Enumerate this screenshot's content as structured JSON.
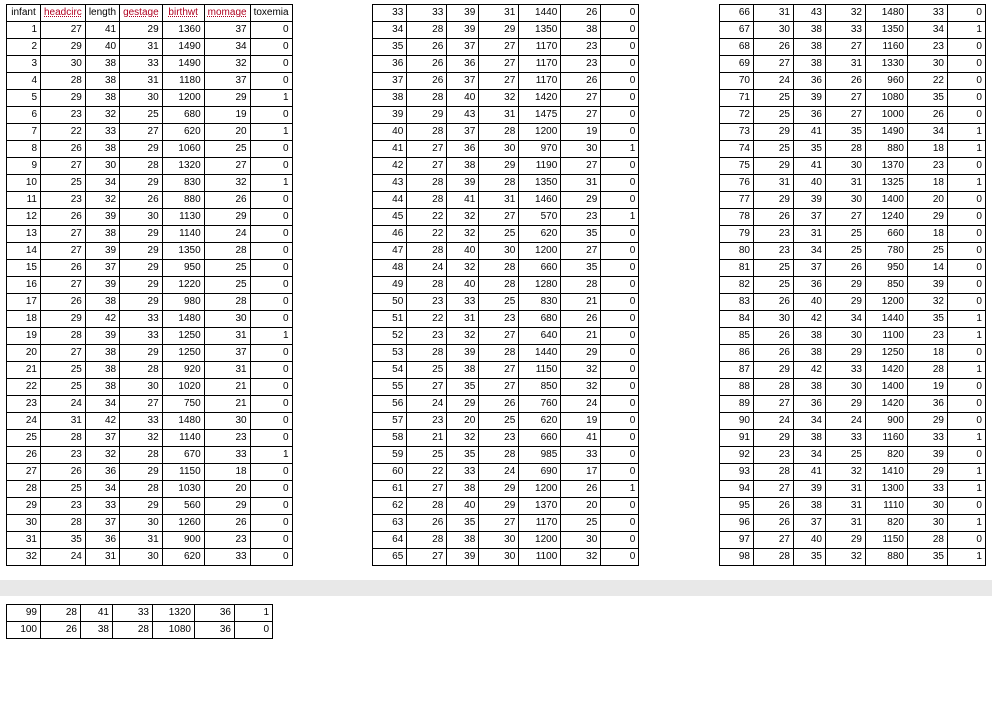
{
  "headers": {
    "infant": {
      "label": "infant",
      "styled": false
    },
    "headcirc": {
      "label": "headcirc",
      "styled": true
    },
    "length": {
      "label": "length",
      "styled": false
    },
    "gestage": {
      "label": "gestage",
      "styled": true
    },
    "birthwt": {
      "label": "birthwt",
      "styled": true
    },
    "momage": {
      "label": "momage",
      "styled": true
    },
    "toxemia": {
      "label": "toxemia",
      "styled": false
    }
  },
  "rows": [
    {
      "infant": 1,
      "headcirc": 27,
      "length": 41,
      "gestage": 29,
      "birthwt": 1360,
      "momage": 37,
      "toxemia": 0
    },
    {
      "infant": 2,
      "headcirc": 29,
      "length": 40,
      "gestage": 31,
      "birthwt": 1490,
      "momage": 34,
      "toxemia": 0
    },
    {
      "infant": 3,
      "headcirc": 30,
      "length": 38,
      "gestage": 33,
      "birthwt": 1490,
      "momage": 32,
      "toxemia": 0
    },
    {
      "infant": 4,
      "headcirc": 28,
      "length": 38,
      "gestage": 31,
      "birthwt": 1180,
      "momage": 37,
      "toxemia": 0
    },
    {
      "infant": 5,
      "headcirc": 29,
      "length": 38,
      "gestage": 30,
      "birthwt": 1200,
      "momage": 29,
      "toxemia": 1
    },
    {
      "infant": 6,
      "headcirc": 23,
      "length": 32,
      "gestage": 25,
      "birthwt": 680,
      "momage": 19,
      "toxemia": 0
    },
    {
      "infant": 7,
      "headcirc": 22,
      "length": 33,
      "gestage": 27,
      "birthwt": 620,
      "momage": 20,
      "toxemia": 1
    },
    {
      "infant": 8,
      "headcirc": 26,
      "length": 38,
      "gestage": 29,
      "birthwt": 1060,
      "momage": 25,
      "toxemia": 0
    },
    {
      "infant": 9,
      "headcirc": 27,
      "length": 30,
      "gestage": 28,
      "birthwt": 1320,
      "momage": 27,
      "toxemia": 0
    },
    {
      "infant": 10,
      "headcirc": 25,
      "length": 34,
      "gestage": 29,
      "birthwt": 830,
      "momage": 32,
      "toxemia": 1
    },
    {
      "infant": 11,
      "headcirc": 23,
      "length": 32,
      "gestage": 26,
      "birthwt": 880,
      "momage": 26,
      "toxemia": 0
    },
    {
      "infant": 12,
      "headcirc": 26,
      "length": 39,
      "gestage": 30,
      "birthwt": 1130,
      "momage": 29,
      "toxemia": 0
    },
    {
      "infant": 13,
      "headcirc": 27,
      "length": 38,
      "gestage": 29,
      "birthwt": 1140,
      "momage": 24,
      "toxemia": 0
    },
    {
      "infant": 14,
      "headcirc": 27,
      "length": 39,
      "gestage": 29,
      "birthwt": 1350,
      "momage": 28,
      "toxemia": 0
    },
    {
      "infant": 15,
      "headcirc": 26,
      "length": 37,
      "gestage": 29,
      "birthwt": 950,
      "momage": 25,
      "toxemia": 0
    },
    {
      "infant": 16,
      "headcirc": 27,
      "length": 39,
      "gestage": 29,
      "birthwt": 1220,
      "momage": 25,
      "toxemia": 0
    },
    {
      "infant": 17,
      "headcirc": 26,
      "length": 38,
      "gestage": 29,
      "birthwt": 980,
      "momage": 28,
      "toxemia": 0
    },
    {
      "infant": 18,
      "headcirc": 29,
      "length": 42,
      "gestage": 33,
      "birthwt": 1480,
      "momage": 30,
      "toxemia": 0
    },
    {
      "infant": 19,
      "headcirc": 28,
      "length": 39,
      "gestage": 33,
      "birthwt": 1250,
      "momage": 31,
      "toxemia": 1
    },
    {
      "infant": 20,
      "headcirc": 27,
      "length": 38,
      "gestage": 29,
      "birthwt": 1250,
      "momage": 37,
      "toxemia": 0
    },
    {
      "infant": 21,
      "headcirc": 25,
      "length": 38,
      "gestage": 28,
      "birthwt": 920,
      "momage": 31,
      "toxemia": 0
    },
    {
      "infant": 22,
      "headcirc": 25,
      "length": 38,
      "gestage": 30,
      "birthwt": 1020,
      "momage": 21,
      "toxemia": 0
    },
    {
      "infant": 23,
      "headcirc": 24,
      "length": 34,
      "gestage": 27,
      "birthwt": 750,
      "momage": 21,
      "toxemia": 0
    },
    {
      "infant": 24,
      "headcirc": 31,
      "length": 42,
      "gestage": 33,
      "birthwt": 1480,
      "momage": 30,
      "toxemia": 0
    },
    {
      "infant": 25,
      "headcirc": 28,
      "length": 37,
      "gestage": 32,
      "birthwt": 1140,
      "momage": 23,
      "toxemia": 0
    },
    {
      "infant": 26,
      "headcirc": 23,
      "length": 32,
      "gestage": 28,
      "birthwt": 670,
      "momage": 33,
      "toxemia": 1
    },
    {
      "infant": 27,
      "headcirc": 26,
      "length": 36,
      "gestage": 29,
      "birthwt": 1150,
      "momage": 18,
      "toxemia": 0
    },
    {
      "infant": 28,
      "headcirc": 25,
      "length": 34,
      "gestage": 28,
      "birthwt": 1030,
      "momage": 20,
      "toxemia": 0
    },
    {
      "infant": 29,
      "headcirc": 23,
      "length": 33,
      "gestage": 29,
      "birthwt": 560,
      "momage": 29,
      "toxemia": 0
    },
    {
      "infant": 30,
      "headcirc": 28,
      "length": 37,
      "gestage": 30,
      "birthwt": 1260,
      "momage": 26,
      "toxemia": 0
    },
    {
      "infant": 31,
      "headcirc": 35,
      "length": 36,
      "gestage": 31,
      "birthwt": 900,
      "momage": 23,
      "toxemia": 0
    },
    {
      "infant": 32,
      "headcirc": 24,
      "length": 31,
      "gestage": 30,
      "birthwt": 620,
      "momage": 33,
      "toxemia": 0
    },
    {
      "infant": 33,
      "headcirc": 33,
      "length": 39,
      "gestage": 31,
      "birthwt": 1440,
      "momage": 26,
      "toxemia": 0
    },
    {
      "infant": 34,
      "headcirc": 28,
      "length": 39,
      "gestage": 29,
      "birthwt": 1350,
      "momage": 38,
      "toxemia": 0
    },
    {
      "infant": 35,
      "headcirc": 26,
      "length": 37,
      "gestage": 27,
      "birthwt": 1170,
      "momage": 23,
      "toxemia": 0
    },
    {
      "infant": 36,
      "headcirc": 26,
      "length": 36,
      "gestage": 27,
      "birthwt": 1170,
      "momage": 23,
      "toxemia": 0
    },
    {
      "infant": 37,
      "headcirc": 26,
      "length": 37,
      "gestage": 27,
      "birthwt": 1170,
      "momage": 26,
      "toxemia": 0
    },
    {
      "infant": 38,
      "headcirc": 28,
      "length": 40,
      "gestage": 32,
      "birthwt": 1420,
      "momage": 27,
      "toxemia": 0
    },
    {
      "infant": 39,
      "headcirc": 29,
      "length": 43,
      "gestage": 31,
      "birthwt": 1475,
      "momage": 27,
      "toxemia": 0
    },
    {
      "infant": 40,
      "headcirc": 28,
      "length": 37,
      "gestage": 28,
      "birthwt": 1200,
      "momage": 19,
      "toxemia": 0
    },
    {
      "infant": 41,
      "headcirc": 27,
      "length": 36,
      "gestage": 30,
      "birthwt": 970,
      "momage": 30,
      "toxemia": 1
    },
    {
      "infant": 42,
      "headcirc": 27,
      "length": 38,
      "gestage": 29,
      "birthwt": 1190,
      "momage": 27,
      "toxemia": 0
    },
    {
      "infant": 43,
      "headcirc": 28,
      "length": 39,
      "gestage": 28,
      "birthwt": 1350,
      "momage": 31,
      "toxemia": 0
    },
    {
      "infant": 44,
      "headcirc": 28,
      "length": 41,
      "gestage": 31,
      "birthwt": 1460,
      "momage": 29,
      "toxemia": 0
    },
    {
      "infant": 45,
      "headcirc": 22,
      "length": 32,
      "gestage": 27,
      "birthwt": 570,
      "momage": 23,
      "toxemia": 1
    },
    {
      "infant": 46,
      "headcirc": 22,
      "length": 32,
      "gestage": 25,
      "birthwt": 620,
      "momage": 35,
      "toxemia": 0
    },
    {
      "infant": 47,
      "headcirc": 28,
      "length": 40,
      "gestage": 30,
      "birthwt": 1200,
      "momage": 27,
      "toxemia": 0
    },
    {
      "infant": 48,
      "headcirc": 24,
      "length": 32,
      "gestage": 28,
      "birthwt": 660,
      "momage": 35,
      "toxemia": 0
    },
    {
      "infant": 49,
      "headcirc": 28,
      "length": 40,
      "gestage": 28,
      "birthwt": 1280,
      "momage": 28,
      "toxemia": 0
    },
    {
      "infant": 50,
      "headcirc": 23,
      "length": 33,
      "gestage": 25,
      "birthwt": 830,
      "momage": 21,
      "toxemia": 0
    },
    {
      "infant": 51,
      "headcirc": 22,
      "length": 31,
      "gestage": 23,
      "birthwt": 680,
      "momage": 26,
      "toxemia": 0
    },
    {
      "infant": 52,
      "headcirc": 23,
      "length": 32,
      "gestage": 27,
      "birthwt": 640,
      "momage": 21,
      "toxemia": 0
    },
    {
      "infant": 53,
      "headcirc": 28,
      "length": 39,
      "gestage": 28,
      "birthwt": 1440,
      "momage": 29,
      "toxemia": 0
    },
    {
      "infant": 54,
      "headcirc": 25,
      "length": 38,
      "gestage": 27,
      "birthwt": 1150,
      "momage": 32,
      "toxemia": 0
    },
    {
      "infant": 55,
      "headcirc": 27,
      "length": 35,
      "gestage": 27,
      "birthwt": 850,
      "momage": 32,
      "toxemia": 0
    },
    {
      "infant": 56,
      "headcirc": 24,
      "length": 29,
      "gestage": 26,
      "birthwt": 760,
      "momage": 24,
      "toxemia": 0
    },
    {
      "infant": 57,
      "headcirc": 23,
      "length": 20,
      "gestage": 25,
      "birthwt": 620,
      "momage": 19,
      "toxemia": 0
    },
    {
      "infant": 58,
      "headcirc": 21,
      "length": 32,
      "gestage": 23,
      "birthwt": 660,
      "momage": 41,
      "toxemia": 0
    },
    {
      "infant": 59,
      "headcirc": 25,
      "length": 35,
      "gestage": 28,
      "birthwt": 985,
      "momage": 33,
      "toxemia": 0
    },
    {
      "infant": 60,
      "headcirc": 22,
      "length": 33,
      "gestage": 24,
      "birthwt": 690,
      "momage": 17,
      "toxemia": 0
    },
    {
      "infant": 61,
      "headcirc": 27,
      "length": 38,
      "gestage": 29,
      "birthwt": 1200,
      "momage": 26,
      "toxemia": 1
    },
    {
      "infant": 62,
      "headcirc": 28,
      "length": 40,
      "gestage": 29,
      "birthwt": 1370,
      "momage": 20,
      "toxemia": 0
    },
    {
      "infant": 63,
      "headcirc": 26,
      "length": 35,
      "gestage": 27,
      "birthwt": 1170,
      "momage": 25,
      "toxemia": 0
    },
    {
      "infant": 64,
      "headcirc": 28,
      "length": 38,
      "gestage": 30,
      "birthwt": 1200,
      "momage": 30,
      "toxemia": 0
    },
    {
      "infant": 65,
      "headcirc": 27,
      "length": 39,
      "gestage": 30,
      "birthwt": 1100,
      "momage": 32,
      "toxemia": 0
    },
    {
      "infant": 66,
      "headcirc": 31,
      "length": 43,
      "gestage": 32,
      "birthwt": 1480,
      "momage": 33,
      "toxemia": 0
    },
    {
      "infant": 67,
      "headcirc": 30,
      "length": 38,
      "gestage": 33,
      "birthwt": 1350,
      "momage": 34,
      "toxemia": 1
    },
    {
      "infant": 68,
      "headcirc": 26,
      "length": 38,
      "gestage": 27,
      "birthwt": 1160,
      "momage": 23,
      "toxemia": 0
    },
    {
      "infant": 69,
      "headcirc": 27,
      "length": 38,
      "gestage": 31,
      "birthwt": 1330,
      "momage": 30,
      "toxemia": 0
    },
    {
      "infant": 70,
      "headcirc": 24,
      "length": 36,
      "gestage": 26,
      "birthwt": 960,
      "momage": 22,
      "toxemia": 0
    },
    {
      "infant": 71,
      "headcirc": 25,
      "length": 39,
      "gestage": 27,
      "birthwt": 1080,
      "momage": 35,
      "toxemia": 0
    },
    {
      "infant": 72,
      "headcirc": 25,
      "length": 36,
      "gestage": 27,
      "birthwt": 1000,
      "momage": 26,
      "toxemia": 0
    },
    {
      "infant": 73,
      "headcirc": 29,
      "length": 41,
      "gestage": 35,
      "birthwt": 1490,
      "momage": 34,
      "toxemia": 1
    },
    {
      "infant": 74,
      "headcirc": 25,
      "length": 35,
      "gestage": 28,
      "birthwt": 880,
      "momage": 18,
      "toxemia": 1
    },
    {
      "infant": 75,
      "headcirc": 29,
      "length": 41,
      "gestage": 30,
      "birthwt": 1370,
      "momage": 23,
      "toxemia": 0
    },
    {
      "infant": 76,
      "headcirc": 31,
      "length": 40,
      "gestage": 31,
      "birthwt": 1325,
      "momage": 18,
      "toxemia": 1
    },
    {
      "infant": 77,
      "headcirc": 29,
      "length": 39,
      "gestage": 30,
      "birthwt": 1400,
      "momage": 20,
      "toxemia": 0
    },
    {
      "infant": 78,
      "headcirc": 26,
      "length": 37,
      "gestage": 27,
      "birthwt": 1240,
      "momage": 29,
      "toxemia": 0
    },
    {
      "infant": 79,
      "headcirc": 23,
      "length": 31,
      "gestage": 25,
      "birthwt": 660,
      "momage": 18,
      "toxemia": 0
    },
    {
      "infant": 80,
      "headcirc": 23,
      "length": 34,
      "gestage": 25,
      "birthwt": 780,
      "momage": 25,
      "toxemia": 0
    },
    {
      "infant": 81,
      "headcirc": 25,
      "length": 37,
      "gestage": 26,
      "birthwt": 950,
      "momage": 14,
      "toxemia": 0
    },
    {
      "infant": 82,
      "headcirc": 25,
      "length": 36,
      "gestage": 29,
      "birthwt": 850,
      "momage": 39,
      "toxemia": 0
    },
    {
      "infant": 83,
      "headcirc": 26,
      "length": 40,
      "gestage": 29,
      "birthwt": 1200,
      "momage": 32,
      "toxemia": 0
    },
    {
      "infant": 84,
      "headcirc": 30,
      "length": 42,
      "gestage": 34,
      "birthwt": 1440,
      "momage": 35,
      "toxemia": 1
    },
    {
      "infant": 85,
      "headcirc": 26,
      "length": 38,
      "gestage": 30,
      "birthwt": 1100,
      "momage": 23,
      "toxemia": 1
    },
    {
      "infant": 86,
      "headcirc": 26,
      "length": 38,
      "gestage": 29,
      "birthwt": 1250,
      "momage": 18,
      "toxemia": 0
    },
    {
      "infant": 87,
      "headcirc": 29,
      "length": 42,
      "gestage": 33,
      "birthwt": 1420,
      "momage": 28,
      "toxemia": 1
    },
    {
      "infant": 88,
      "headcirc": 28,
      "length": 38,
      "gestage": 30,
      "birthwt": 1400,
      "momage": 19,
      "toxemia": 0
    },
    {
      "infant": 89,
      "headcirc": 27,
      "length": 36,
      "gestage": 29,
      "birthwt": 1420,
      "momage": 36,
      "toxemia": 0
    },
    {
      "infant": 90,
      "headcirc": 24,
      "length": 34,
      "gestage": 24,
      "birthwt": 900,
      "momage": 29,
      "toxemia": 0
    },
    {
      "infant": 91,
      "headcirc": 29,
      "length": 38,
      "gestage": 33,
      "birthwt": 1160,
      "momage": 33,
      "toxemia": 1
    },
    {
      "infant": 92,
      "headcirc": 23,
      "length": 34,
      "gestage": 25,
      "birthwt": 820,
      "momage": 39,
      "toxemia": 0
    },
    {
      "infant": 93,
      "headcirc": 28,
      "length": 41,
      "gestage": 32,
      "birthwt": 1410,
      "momage": 29,
      "toxemia": 1
    },
    {
      "infant": 94,
      "headcirc": 27,
      "length": 39,
      "gestage": 31,
      "birthwt": 1300,
      "momage": 33,
      "toxemia": 1
    },
    {
      "infant": 95,
      "headcirc": 26,
      "length": 38,
      "gestage": 31,
      "birthwt": 1110,
      "momage": 30,
      "toxemia": 0
    },
    {
      "infant": 96,
      "headcirc": 26,
      "length": 37,
      "gestage": 31,
      "birthwt": 820,
      "momage": 30,
      "toxemia": 1
    },
    {
      "infant": 97,
      "headcirc": 27,
      "length": 40,
      "gestage": 29,
      "birthwt": 1150,
      "momage": 28,
      "toxemia": 0
    },
    {
      "infant": 98,
      "headcirc": 28,
      "length": 35,
      "gestage": 32,
      "birthwt": 880,
      "momage": 35,
      "toxemia": 1
    },
    {
      "infant": 99,
      "headcirc": 28,
      "length": 41,
      "gestage": 33,
      "birthwt": 1320,
      "momage": 36,
      "toxemia": 1
    },
    {
      "infant": 100,
      "headcirc": 26,
      "length": 38,
      "gestage": 28,
      "birthwt": 1080,
      "momage": 36,
      "toxemia": 0
    }
  ],
  "layout": {
    "pages": [
      {
        "columns": [
          {
            "start": 0,
            "end": 32,
            "header": true
          },
          {
            "start": 32,
            "end": 65,
            "header": false
          },
          {
            "start": 65,
            "end": 98,
            "header": false
          }
        ]
      },
      {
        "columns": [
          {
            "start": 98,
            "end": 100,
            "header": false
          }
        ]
      }
    ]
  }
}
